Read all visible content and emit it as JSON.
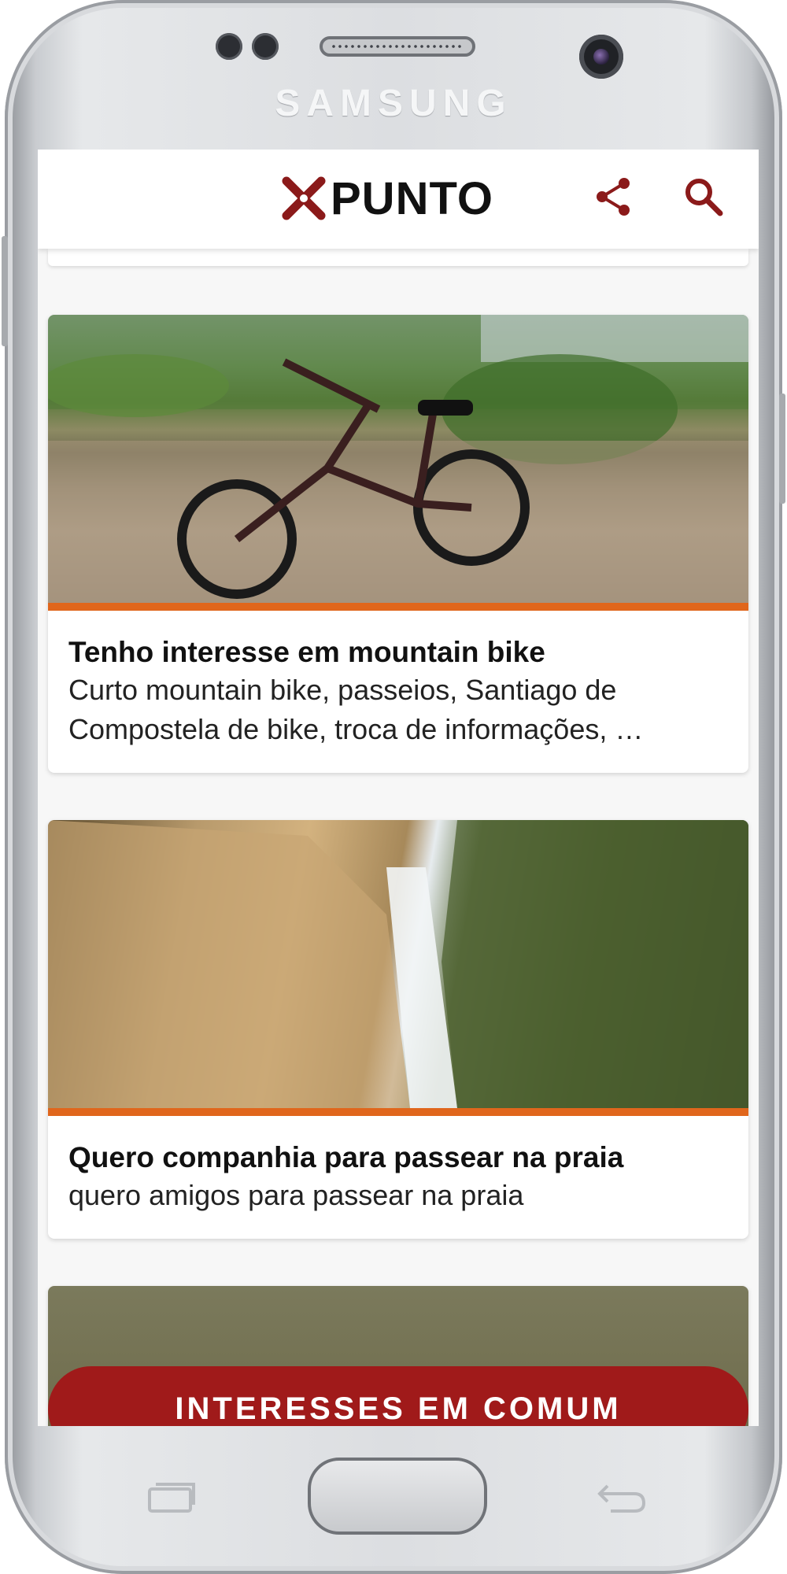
{
  "device": {
    "brand": "SAMSUNG"
  },
  "header": {
    "logo_text": "PUNTO",
    "logo_mark": "x-logo-icon",
    "share_icon": "share-icon",
    "search_icon": "search-icon",
    "accent_color": "#8b1a1a"
  },
  "cards": [
    {
      "title": "Tenho interesse em mountain bike",
      "description": "Curto mountain bike, passeios,  Santiago de Compostela de bike, troca de informações,  …"
    },
    {
      "title": "Quero companhia para passear na praia",
      "description": "quero amigos para passear na praia"
    }
  ],
  "fab": {
    "label": "INTERESSES EM COMUM",
    "color": "#a01a1a"
  },
  "colors": {
    "card_accent": "#e0661c"
  }
}
